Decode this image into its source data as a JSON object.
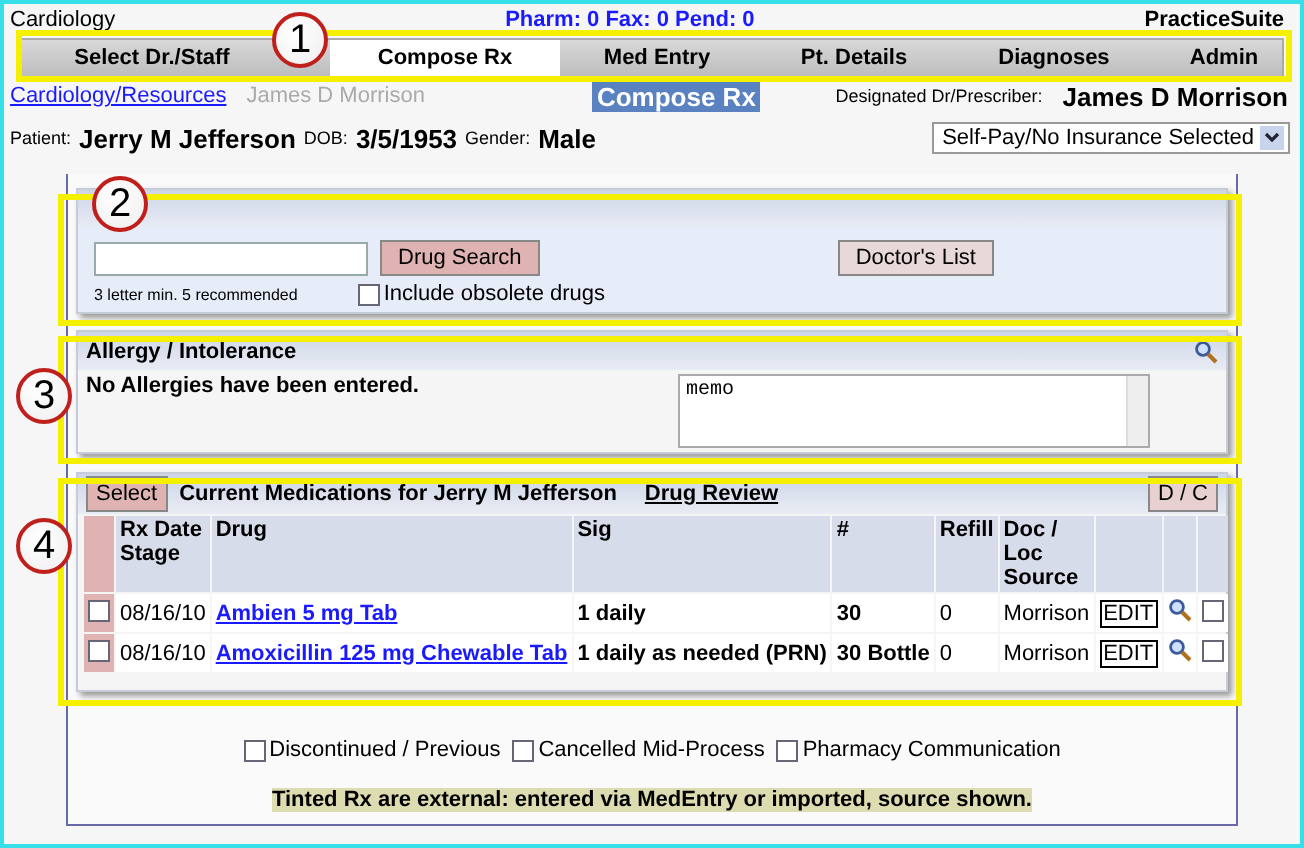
{
  "header": {
    "left": "Cardiology",
    "counts": "Pharm: 0  Fax: 0  Pend: 0",
    "brand": "PracticeSuite"
  },
  "tabs": [
    {
      "label": "Select Dr./Staff",
      "selected": false
    },
    {
      "label": "Compose Rx",
      "selected": true
    },
    {
      "label": "Med Entry",
      "selected": false
    },
    {
      "label": "Pt. Details",
      "selected": false
    },
    {
      "label": "Diagnoses",
      "selected": false
    },
    {
      "label": "Admin",
      "selected": false
    }
  ],
  "subheader": {
    "link": "Cardiology/Resources",
    "doctor": "James D Morrison",
    "page_title": "Compose Rx",
    "designated_label": "Designated Dr/Prescriber:",
    "designated_name": "James D Morrison"
  },
  "patient": {
    "patient_label": "Patient:",
    "name": "Jerry M Jefferson",
    "dob_label": "DOB:",
    "dob": "3/5/1953",
    "gender_label": "Gender:",
    "gender": "Male",
    "insurance": "Self-Pay/No Insurance Selected"
  },
  "search": {
    "button": "Drug Search",
    "doctors_button": "Doctor's List",
    "hint": "3 letter min. 5 recommended",
    "obsolete_label": "Include obsolete drugs",
    "obsolete_checked": false
  },
  "allergy": {
    "title": "Allergy / Intolerance",
    "message": "No Allergies have been entered.",
    "memo": "memo"
  },
  "medications": {
    "select_button": "Select",
    "title": "Current Medications for Jerry M Jefferson",
    "review_link": "Drug Review",
    "dc_button": "D / C",
    "columns": [
      "Rx Date Stage",
      "Drug",
      "Sig",
      "#",
      "Refill",
      "Doc / Loc Source"
    ],
    "rows": [
      {
        "checked": false,
        "date": "08/16/10",
        "drug": "Ambien 5 mg Tab",
        "sig": "1 daily",
        "qty": "30",
        "refill": "0",
        "source": "Morrison",
        "edit": "EDIT",
        "dc_checked": false
      },
      {
        "checked": false,
        "date": "08/16/10",
        "drug": "Amoxicillin 125 mg Chewable Tab",
        "sig": "1 daily as needed (PRN)",
        "qty": "30 Bottle",
        "refill": "0",
        "source": "Morrison",
        "edit": "EDIT",
        "dc_checked": false
      }
    ]
  },
  "filters": [
    {
      "label": "Discontinued / Previous",
      "checked": false
    },
    {
      "label": "Cancelled Mid-Process",
      "checked": false
    },
    {
      "label": "Pharmacy Communication",
      "checked": false
    }
  ],
  "note": "Tinted Rx are external: entered via MedEntry or imported, source shown.",
  "callouts": [
    "1",
    "2",
    "3",
    "4"
  ]
}
